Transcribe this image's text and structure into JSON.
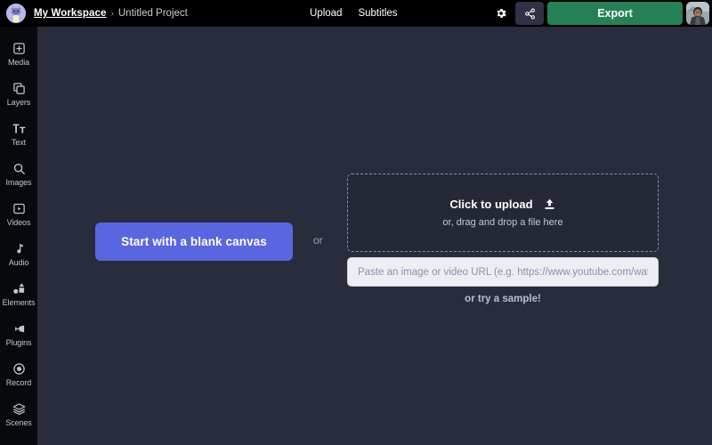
{
  "topbar": {
    "logo_icon": "workspace-cat-avatar",
    "breadcrumb": {
      "workspace": "My Workspace",
      "separator": "›",
      "project": "Untitled Project"
    },
    "nav_links": [
      {
        "label": "Upload",
        "name": "nav-upload"
      },
      {
        "label": "Subtitles",
        "name": "nav-subtitles"
      }
    ],
    "settings_icon": "gear-icon",
    "share_icon": "share-icon",
    "export_label": "Export",
    "avatar_icon": "user-avatar-photo",
    "colors": {
      "topbar_bg": "#000000",
      "export_green": "#268055",
      "share_bg": "#2e3244"
    }
  },
  "sidebar": {
    "items": [
      {
        "label": "Media",
        "icon": "media-add-icon"
      },
      {
        "label": "Layers",
        "icon": "layers-copy-icon"
      },
      {
        "label": "Text",
        "icon": "text-tt-icon"
      },
      {
        "label": "Images",
        "icon": "search-images-icon"
      },
      {
        "label": "Videos",
        "icon": "video-play-icon"
      },
      {
        "label": "Audio",
        "icon": "music-note-icon"
      },
      {
        "label": "Elements",
        "icon": "shapes-elements-icon"
      },
      {
        "label": "Plugins",
        "icon": "plug-icon"
      },
      {
        "label": "Record",
        "icon": "record-circle-icon"
      },
      {
        "label": "Scenes",
        "icon": "scenes-stack-icon"
      }
    ],
    "colors": {
      "bg": "#08090c",
      "icon": "#c2c5cc"
    }
  },
  "main": {
    "blank_canvas_label": "Start with a blank canvas",
    "or_divider": "or",
    "dropzone": {
      "title": "Click to upload",
      "icon": "upload-arrow-icon",
      "subtitle": "or, drag and drop a file here"
    },
    "url_input": {
      "value": "",
      "placeholder": "Paste an image or video URL (e.g. https://www.youtube.com/watch?v=C"
    },
    "sample_link": "or try a sample!",
    "colors": {
      "canvas_bg": "#282c3c",
      "primary_button": "#5a66e0",
      "dropzone_bg": "#252836",
      "dropzone_border": "#8b90a3",
      "input_bg": "#eceef2",
      "sample_link": "#b9bed8"
    }
  }
}
